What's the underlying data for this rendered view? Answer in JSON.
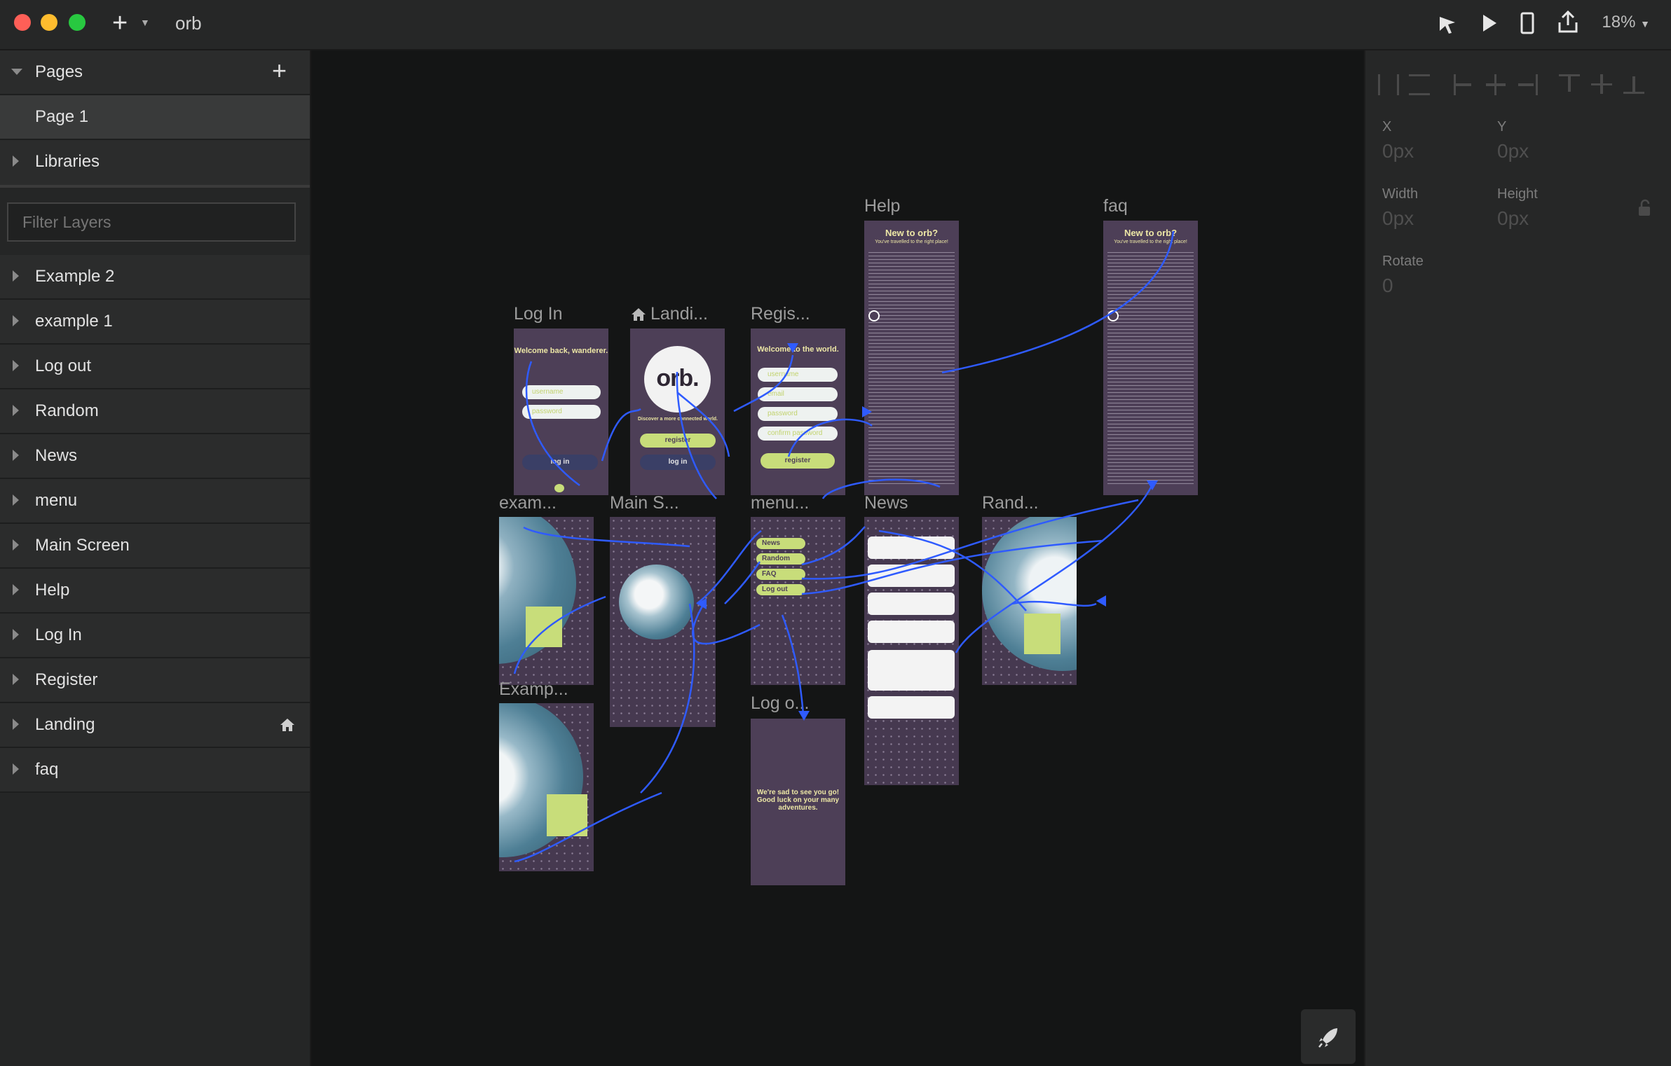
{
  "app": {
    "title": "orb",
    "zoom": "18%"
  },
  "sidebar": {
    "pages_header": "Pages",
    "pages": [
      "Page 1"
    ],
    "libraries": "Libraries",
    "filter_placeholder": "Filter Layers",
    "layers": [
      "Example 2",
      "example 1",
      "Log out",
      "Random",
      "News",
      "menu",
      "Main Screen",
      "Help",
      "Log In",
      "Register",
      "Landing",
      "faq"
    ]
  },
  "inspector": {
    "x_label": "X",
    "x_value": "0px",
    "y_label": "Y",
    "y_value": "0px",
    "width_label": "Width",
    "width_value": "0px",
    "height_label": "Height",
    "height_value": "0px",
    "rotate_label": "Rotate",
    "rotate_value": "0"
  },
  "artboards": {
    "login": {
      "title": "Log In",
      "welcome": "Welcome back, wanderer.",
      "username": "username",
      "password": "password",
      "button": "log in"
    },
    "landing": {
      "title": "Landi...",
      "logo": "orb.",
      "tagline": "Discover a more connected world.",
      "register": "register",
      "login": "log in"
    },
    "register": {
      "title": "Regis...",
      "welcome": "Welcome to the world.",
      "fields": [
        "username",
        "email",
        "password",
        "confirm password"
      ],
      "button": "register"
    },
    "help": {
      "title": "Help",
      "heading": "New to orb?",
      "subheading": "You've travelled to the right place!"
    },
    "faq": {
      "title": "faq",
      "heading": "New to orb?",
      "subheading": "You've travelled to the right place!"
    },
    "example1": {
      "title": "exam..."
    },
    "main": {
      "title": "Main S..."
    },
    "menu": {
      "title": "menu...",
      "items": [
        "News",
        "Random",
        "FAQ",
        "Log out"
      ]
    },
    "news": {
      "title": "News"
    },
    "random": {
      "title": "Rand..."
    },
    "example2": {
      "title": "Examp..."
    },
    "logout": {
      "title": "Log o...",
      "message": "We're sad to see you go! Good luck on your many adventures."
    }
  },
  "colors": {
    "artboard": "#4d3f57",
    "accent": "#c8dd7a",
    "link": "#2f5bff",
    "ocean": "#4e7f95"
  }
}
